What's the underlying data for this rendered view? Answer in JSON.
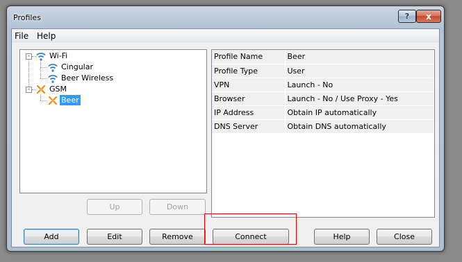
{
  "window": {
    "title": "Profiles"
  },
  "titlebar": {
    "help_glyph": "?",
    "close_glyph": "x"
  },
  "menu": {
    "items": [
      "File",
      "Help"
    ]
  },
  "tree": {
    "wifi": {
      "label": "Wi-Fi",
      "expander": "-",
      "children": [
        "Cingular",
        "Beer Wireless"
      ]
    },
    "gsm": {
      "label": "GSM",
      "expander": "-",
      "children": [
        "Beer"
      ]
    },
    "selected": "Beer"
  },
  "properties": {
    "rows": [
      {
        "key": "Profile Name",
        "value": "Beer"
      },
      {
        "key": "Profile Type",
        "value": "User"
      },
      {
        "key": "VPN",
        "value": "Launch - No"
      },
      {
        "key": "Browser",
        "value": "Launch - No  /  Use Proxy - Yes"
      },
      {
        "key": "IP Address",
        "value": "Obtain IP automatically"
      },
      {
        "key": "DNS Server",
        "value": "Obtain DNS automatically"
      }
    ]
  },
  "buttons": {
    "up": "Up",
    "down": "Down",
    "add": "Add",
    "edit": "Edit",
    "remove": "Remove",
    "connect": "Connect",
    "help": "Help",
    "close": "Close"
  },
  "colors": {
    "selection": "#3399ff",
    "wifi_icon": "#2f7fcf",
    "gsm_icon": "#f08a10",
    "highlight": "#e00000"
  }
}
